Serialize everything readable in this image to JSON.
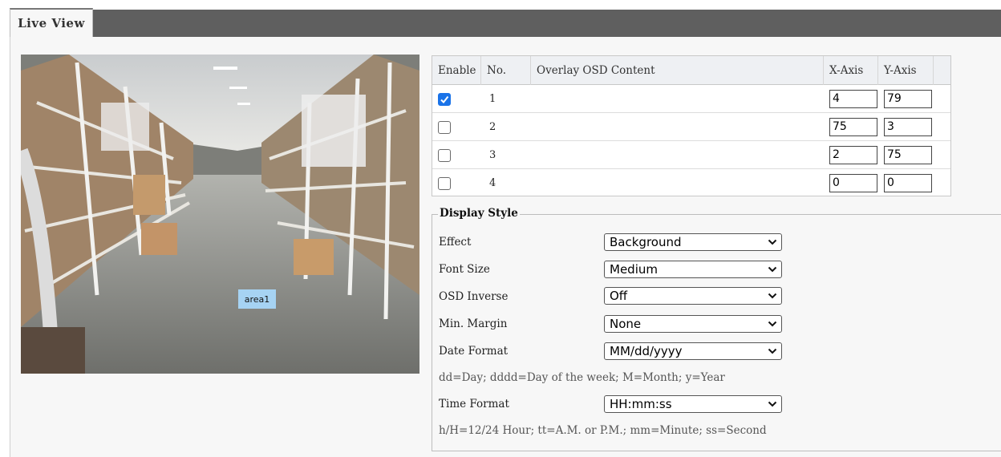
{
  "tabs": {
    "live_view": "Live View"
  },
  "video": {
    "area_label": "area1"
  },
  "osd": {
    "headers": {
      "enable": "Enable",
      "no": "No.",
      "content": "Overlay OSD Content",
      "x": "X-Axis",
      "y": "Y-Axis"
    },
    "rows": [
      {
        "enabled": true,
        "no": "1",
        "x": "4",
        "y": "79"
      },
      {
        "enabled": false,
        "no": "2",
        "x": "75",
        "y": "3"
      },
      {
        "enabled": false,
        "no": "3",
        "x": "2",
        "y": "75"
      },
      {
        "enabled": false,
        "no": "4",
        "x": "0",
        "y": "0"
      }
    ]
  },
  "display_style": {
    "legend": "Display Style",
    "effect": {
      "label": "Effect",
      "value": "Background"
    },
    "font_size": {
      "label": "Font Size",
      "value": "Medium"
    },
    "osd_inverse": {
      "label": "OSD Inverse",
      "value": "Off"
    },
    "min_margin": {
      "label": "Min. Margin",
      "value": "None"
    },
    "date_format": {
      "label": "Date Format",
      "value": "MM/dd/yyyy",
      "hint": "dd=Day; dddd=Day of the week; M=Month; y=Year"
    },
    "time_format": {
      "label": "Time Format",
      "value": "HH:mm:ss",
      "hint": "h/H=12/24 Hour; tt=A.M. or P.M.; mm=Minute; ss=Second"
    }
  },
  "colors": {
    "checkbox_checked": "#1a73e8",
    "tab_bar": "#5f5f5f",
    "area_label_bg": "#a6d3f3"
  }
}
